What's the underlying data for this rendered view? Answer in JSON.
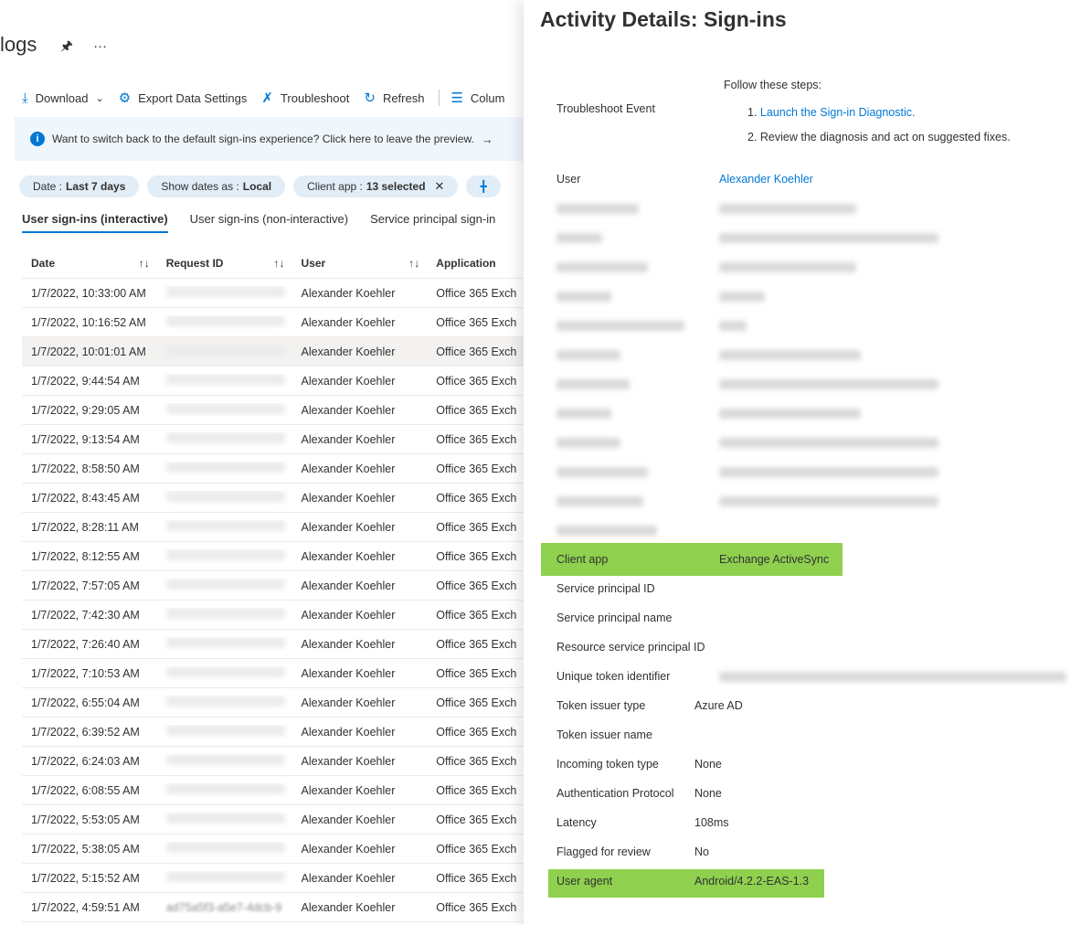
{
  "page": {
    "title": "logs",
    "pin_icon": "pin-icon",
    "more_icon": "more-icon"
  },
  "toolbar": {
    "download": "Download",
    "export": "Export Data Settings",
    "troubleshoot": "Troubleshoot",
    "refresh": "Refresh",
    "columns": "Colum"
  },
  "banner": {
    "text": "Want to switch back to the default sign-ins experience? Click here to leave the preview."
  },
  "filters": [
    {
      "label": "Date :",
      "value": "Last 7 days"
    },
    {
      "label": "Show dates as :",
      "value": "Local"
    },
    {
      "label": "Client app :",
      "value": "13 selected"
    }
  ],
  "tabs": [
    "User sign-ins (interactive)",
    "User sign-ins (non-interactive)",
    "Service principal sign-in"
  ],
  "table": {
    "headers": {
      "date": "Date",
      "request_id": "Request ID",
      "user": "User",
      "application": "Application"
    },
    "rows": [
      {
        "date": "1/7/2022, 10:33:00 AM",
        "req": "",
        "user": "Alexander Koehler",
        "app": "Office 365 Exch"
      },
      {
        "date": "1/7/2022, 10:16:52 AM",
        "req": "",
        "user": "Alexander Koehler",
        "app": "Office 365 Exch"
      },
      {
        "date": "1/7/2022, 10:01:01 AM",
        "req": "",
        "user": "Alexander Koehler",
        "app": "Office 365 Exch"
      },
      {
        "date": "1/7/2022, 9:44:54 AM",
        "req": "",
        "user": "Alexander Koehler",
        "app": "Office 365 Exch"
      },
      {
        "date": "1/7/2022, 9:29:05 AM",
        "req": "",
        "user": "Alexander Koehler",
        "app": "Office 365 Exch"
      },
      {
        "date": "1/7/2022, 9:13:54 AM",
        "req": "",
        "user": "Alexander Koehler",
        "app": "Office 365 Exch"
      },
      {
        "date": "1/7/2022, 8:58:50 AM",
        "req": "",
        "user": "Alexander Koehler",
        "app": "Office 365 Exch"
      },
      {
        "date": "1/7/2022, 8:43:45 AM",
        "req": "",
        "user": "Alexander Koehler",
        "app": "Office 365 Exch"
      },
      {
        "date": "1/7/2022, 8:28:11 AM",
        "req": "",
        "user": "Alexander Koehler",
        "app": "Office 365 Exch"
      },
      {
        "date": "1/7/2022, 8:12:55 AM",
        "req": "",
        "user": "Alexander Koehler",
        "app": "Office 365 Exch"
      },
      {
        "date": "1/7/2022, 7:57:05 AM",
        "req": "",
        "user": "Alexander Koehler",
        "app": "Office 365 Exch"
      },
      {
        "date": "1/7/2022, 7:42:30 AM",
        "req": "",
        "user": "Alexander Koehler",
        "app": "Office 365 Exch"
      },
      {
        "date": "1/7/2022, 7:26:40 AM",
        "req": "",
        "user": "Alexander Koehler",
        "app": "Office 365 Exch"
      },
      {
        "date": "1/7/2022, 7:10:53 AM",
        "req": "",
        "user": "Alexander Koehler",
        "app": "Office 365 Exch"
      },
      {
        "date": "1/7/2022, 6:55:04 AM",
        "req": "",
        "user": "Alexander Koehler",
        "app": "Office 365 Exch"
      },
      {
        "date": "1/7/2022, 6:39:52 AM",
        "req": "",
        "user": "Alexander Koehler",
        "app": "Office 365 Exch"
      },
      {
        "date": "1/7/2022, 6:24:03 AM",
        "req": "",
        "user": "Alexander Koehler",
        "app": "Office 365 Exch"
      },
      {
        "date": "1/7/2022, 6:08:55 AM",
        "req": "",
        "user": "Alexander Koehler",
        "app": "Office 365 Exch"
      },
      {
        "date": "1/7/2022, 5:53:05 AM",
        "req": "",
        "user": "Alexander Koehler",
        "app": "Office 365 Exch"
      },
      {
        "date": "1/7/2022, 5:38:05 AM",
        "req": "",
        "user": "Alexander Koehler",
        "app": "Office 365 Exch"
      },
      {
        "date": "1/7/2022, 5:15:52 AM",
        "req": "",
        "user": "Alexander Koehler",
        "app": "Office 365 Exch"
      },
      {
        "date": "1/7/2022, 4:59:51 AM",
        "req": "ad75a5f3-a5e7-4dcb-9",
        "user": "Alexander Koehler",
        "app": "Office 365 Exch"
      }
    ]
  },
  "panel": {
    "title": "Activity Details: Sign-ins",
    "steps_heading": "Follow these steps:",
    "troubleshoot_label": "Troubleshoot Event",
    "step1_num": "1.",
    "step1_link": "Launch the Sign-in Diagnostic.",
    "step2": "2. Review the diagnosis and act on suggested fixes.",
    "user_label": "User",
    "user_value": "Alexander Koehler",
    "client_app_label": "Client app",
    "client_app_value": "Exchange ActiveSync",
    "details": [
      {
        "label": "Service principal ID",
        "value": ""
      },
      {
        "label": "Service principal name",
        "value": ""
      },
      {
        "label": "Resource service principal ID",
        "value": ""
      },
      {
        "label": "Unique token identifier",
        "value": ""
      },
      {
        "label": "Token issuer type",
        "value": "Azure AD"
      },
      {
        "label": "Token issuer name",
        "value": ""
      },
      {
        "label": "Incoming token type",
        "value": "None"
      },
      {
        "label": "Authentication Protocol",
        "value": "None"
      },
      {
        "label": "Latency",
        "value": "108ms"
      },
      {
        "label": "Flagged for review",
        "value": "No"
      }
    ],
    "user_agent_label": "User agent",
    "user_agent_value": "Android/4.2.2-EAS-1.3"
  },
  "colors": {
    "accent": "#0078d4",
    "highlight": "#8fd14f"
  }
}
